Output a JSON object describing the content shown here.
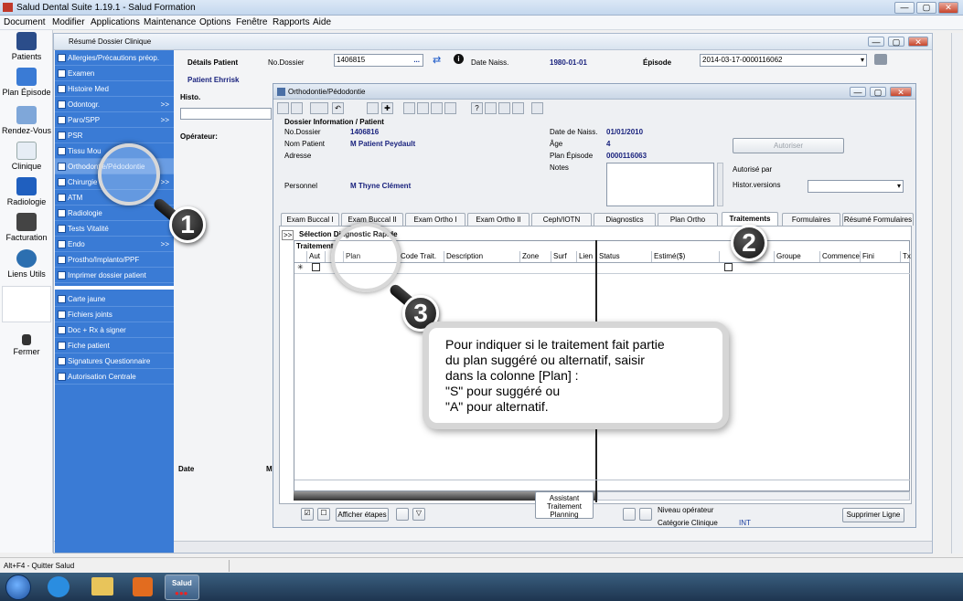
{
  "window": {
    "title": "Salud Dental Suite 1.19.1 - Salud Formation",
    "buttons": [
      "—",
      "▢",
      "✕"
    ]
  },
  "menu": [
    "Document",
    "Modifier",
    "Applications",
    "Maintenance",
    "Options",
    "Fenêtre",
    "Rapports",
    "Aide"
  ],
  "leftbar": [
    {
      "label": "Patients",
      "icon": "patients-icon"
    },
    {
      "label": "Plan Épisode",
      "icon": "plan-episode-icon"
    },
    {
      "label": "Rendez-Vous",
      "icon": "calendar-icon"
    },
    {
      "label": "Clinique",
      "icon": "tooth-icon"
    },
    {
      "label": "Radiologie",
      "icon": "xray-icon"
    },
    {
      "label": "Facturation",
      "icon": "billing-icon"
    },
    {
      "label": "Liens Utils",
      "icon": "globe-icon"
    },
    {
      "label": "Fermer",
      "icon": "exit-icon"
    }
  ],
  "summary": {
    "title": "Résumé Dossier Clinique",
    "details_label": "Détails Patient",
    "dossier_label": "No.Dossier",
    "dossier_value": "1406815",
    "naiss_label": "Date Naiss.",
    "naiss_value": "1980-01-01",
    "episode_label": "Épisode",
    "episode_value": "2014-03-17-0000116062",
    "patient_name": "Patient Ehrrisk",
    "histo_label": "Histo.",
    "operateur_label": "Opérateur:",
    "date_label": "Date",
    "m_label": "M"
  },
  "nav": [
    {
      "label": "Allergies/Précautions préop.",
      "arrow": ""
    },
    {
      "label": "Examen",
      "arrow": ""
    },
    {
      "label": "Histoire Med",
      "arrow": ""
    },
    {
      "label": "Odontogr.",
      "arrow": ">>"
    },
    {
      "label": "Paro/SPP",
      "arrow": ">>"
    },
    {
      "label": "PSR",
      "arrow": ""
    },
    {
      "label": "Tissu Mou",
      "arrow": ""
    },
    {
      "label": "Orthodontie/Pédodontie",
      "arrow": ""
    },
    {
      "label": "Chirurgie",
      "arrow": ">>"
    },
    {
      "label": "ATM",
      "arrow": ""
    },
    {
      "label": "Radiologie",
      "arrow": ""
    },
    {
      "label": "Tests Vitalité",
      "arrow": ""
    },
    {
      "label": "Endo",
      "arrow": ">>"
    },
    {
      "label": "Prostho/Implanto/PPF",
      "arrow": ""
    },
    {
      "label": "Imprimer dossier patient",
      "arrow": ""
    },
    {
      "label": "Carte jaune",
      "arrow": ""
    },
    {
      "label": "Fichiers joints",
      "arrow": ""
    },
    {
      "label": "Doc + Rx à signer",
      "arrow": ""
    },
    {
      "label": "Fiche patient",
      "arrow": ""
    },
    {
      "label": "Signatures Questionnaire",
      "arrow": ""
    },
    {
      "label": "Autorisation Centrale",
      "arrow": ""
    }
  ],
  "ortho": {
    "title": "Orthodontie/Pédodontie",
    "section": "Dossier Information / Patient",
    "dossier_label": "No.Dossier",
    "dossier_value": "1406816",
    "nom_label": "Nom Patient",
    "nom_value": "M Patient Peydault",
    "adresse_label": "Adresse",
    "personnel_label": "Personnel",
    "personnel_value": "M Thyne Clément",
    "naiss_label": "Date de Naiss.",
    "naiss_value": "01/01/2010",
    "age_label": "Âge",
    "age_value": "4",
    "plan_label": "Plan Épisode",
    "plan_value": "0000116063",
    "notes_label": "Notes",
    "autoriser": "Autoriser",
    "autorise_par": "Autorisé par",
    "histor": "Histor.versions",
    "tabs": [
      "Exam Buccal I",
      "Exam Buccal II",
      "Exam Ortho I",
      "Exam Ortho II",
      "Ceph/IOTN",
      "Diagnostics",
      "Plan Ortho",
      "Traitements",
      "Formulaires",
      "Résumé Formulaires"
    ],
    "expand": ">>",
    "selection": "Sélection Diagnostic Rapide",
    "grid_title": "Traitement",
    "columns": [
      "Aut",
      "Plan",
      "Code Trait.",
      "Description",
      "Zone",
      "Surf",
      "Lien",
      "Status",
      "Estimé($)",
      "",
      "Groupe",
      "Commence",
      "Fini",
      "Tx"
    ],
    "row_marker": "✳",
    "afficher": "Afficher étapes",
    "assistant": "Assistant Traitement Planning",
    "niveau": "Niveau opérateur",
    "categorie": "Catégorie Clinique",
    "categorie_value": "INT",
    "supprimer": "Supprimer Ligne"
  },
  "callout": {
    "lines": [
      "Pour indiquer si le traitement fait partie",
      "du plan suggéré ou alternatif, saisir",
      "dans la colonne [Plan] :",
      "\"S\" pour suggéré ou",
      "\"A\" pour alternatif."
    ]
  },
  "badges": [
    "1",
    "2",
    "3"
  ],
  "status": "Alt+F4 - Quitter Salud",
  "taskbar": {
    "salud": "Salud",
    "time_dots": "●●●"
  }
}
